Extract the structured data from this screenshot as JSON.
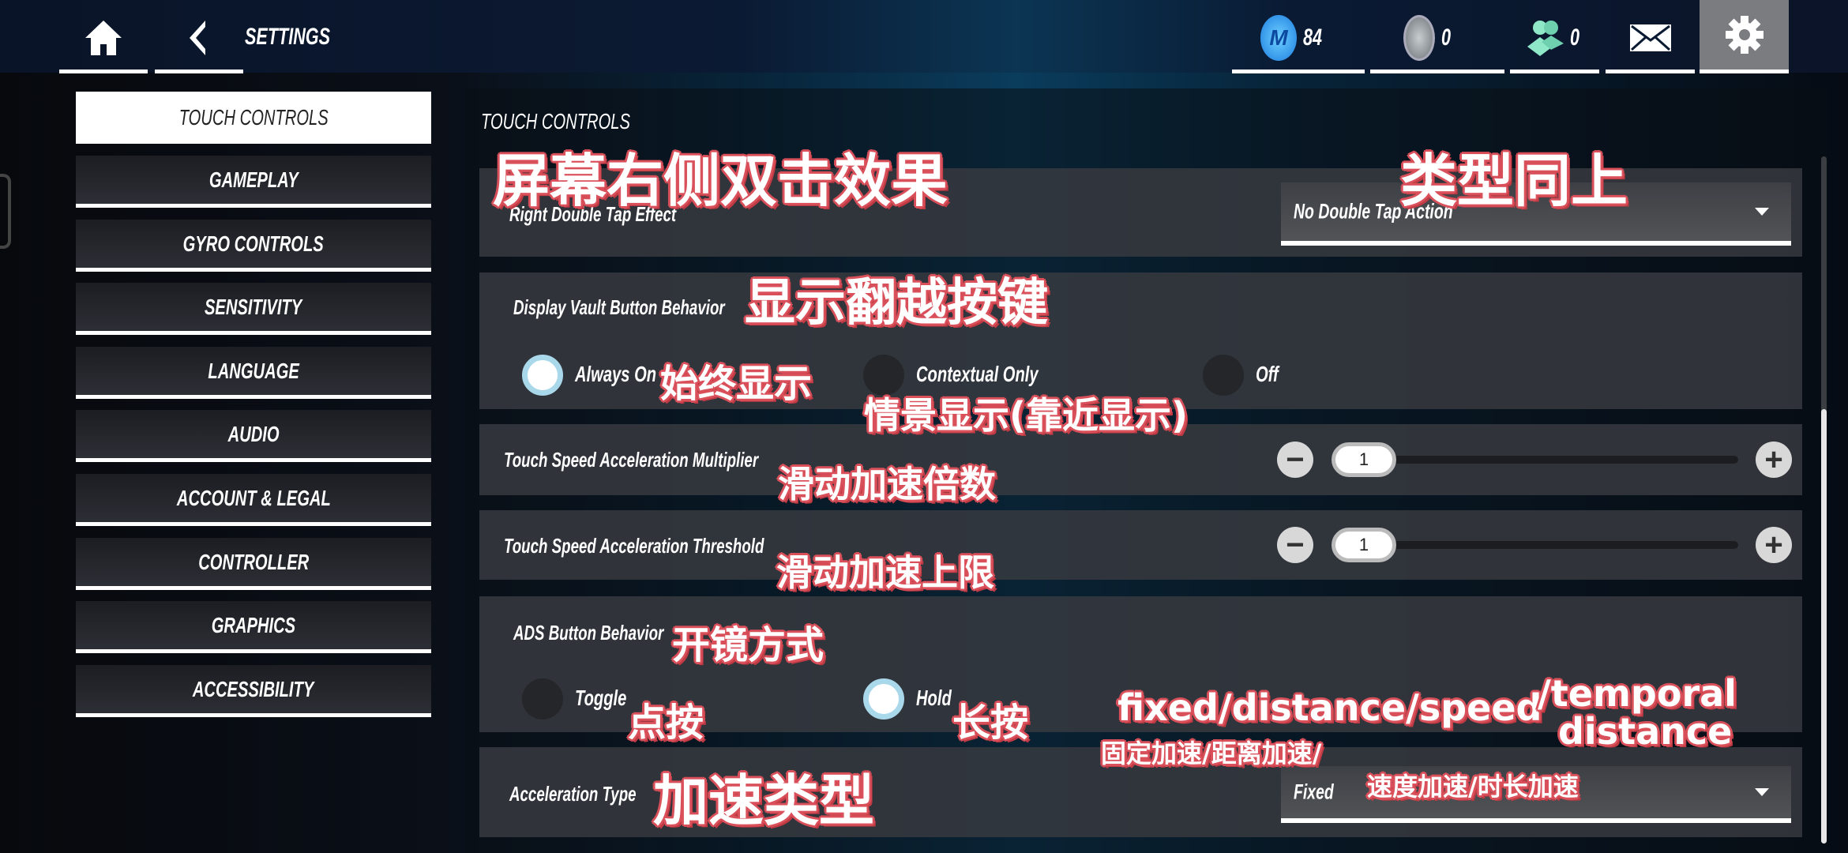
{
  "topbar": {
    "title": "SETTINGS",
    "currencies": [
      {
        "icon": "m-coin-icon",
        "value": "84",
        "color": "#2aa7f5"
      },
      {
        "icon": "r6-credit-icon",
        "value": "0",
        "color": "#9aa3a8"
      },
      {
        "icon": "friends-icon",
        "value": "0",
        "color": "#7fe0c0"
      }
    ],
    "mail_icon": "mail-icon",
    "settings_icon": "gear-icon"
  },
  "sidebar": {
    "items": [
      {
        "label": "TOUCH CONTROLS",
        "active": true
      },
      {
        "label": "GAMEPLAY"
      },
      {
        "label": "GYRO CONTROLS"
      },
      {
        "label": "SENSITIVITY"
      },
      {
        "label": "LANGUAGE"
      },
      {
        "label": "AUDIO"
      },
      {
        "label": "ACCOUNT & LEGAL"
      },
      {
        "label": "CONTROLLER"
      },
      {
        "label": "GRAPHICS"
      },
      {
        "label": "ACCESSIBILITY"
      }
    ]
  },
  "main": {
    "section_title": "TOUCH CONTROLS",
    "right_double_tap": {
      "label": "Right Double Tap Effect",
      "value": "No Double Tap Action"
    },
    "vault_button": {
      "label": "Display Vault Button Behavior",
      "options": [
        "Always On",
        "Contextual Only",
        "Off"
      ],
      "selected": "Always On"
    },
    "speed_multiplier": {
      "label": "Touch Speed Acceleration Multiplier",
      "value": "1"
    },
    "speed_threshold": {
      "label": "Touch Speed Acceleration Threshold",
      "value": "1"
    },
    "ads_button": {
      "label": "ADS Button Behavior",
      "options": [
        "Toggle",
        "Hold"
      ],
      "selected": "Hold"
    },
    "acceleration_type": {
      "label": "Acceleration Type",
      "value": "Fixed"
    }
  },
  "annotations": {
    "right_double_tap": "屏幕右侧双击效果",
    "same_type": "类型同上",
    "vault": "显示翻越按键",
    "always_on": "始终显示",
    "contextual": "情景显示(靠近显示)",
    "multiplier": "滑动加速倍数",
    "threshold": "滑动加速上限",
    "ads": "开镜方式",
    "toggle": "点按",
    "hold": "长按",
    "accel_en1": "fixed/distance/speed",
    "accel_en2": "/temporal",
    "accel_en3": "distance",
    "accel_cn1": "固定加速/距离加速/",
    "accel_cn2": "速度加速/时长加速",
    "accel_type": "加速类型"
  },
  "colors": {
    "accent_radio": "#a8d8ea",
    "annotation_outline": "#d9505a"
  }
}
